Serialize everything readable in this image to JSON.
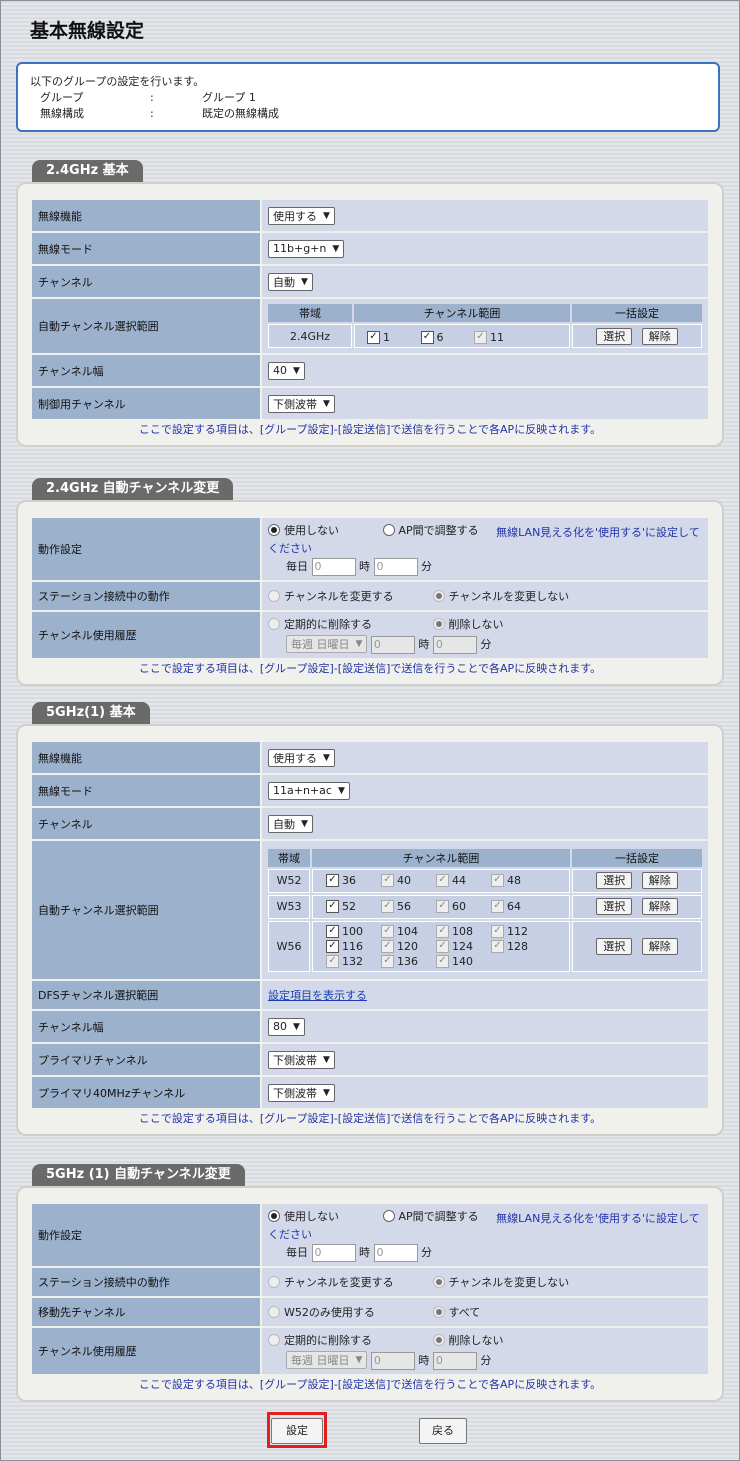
{
  "title": "基本無線設定",
  "info": {
    "intro": "以下のグループの設定を行います。",
    "rows": [
      {
        "key": "グループ",
        "sep": ":",
        "value": "グループ 1"
      },
      {
        "key": "無線構成",
        "sep": ":",
        "value": "既定の無線構成"
      }
    ]
  },
  "note": "ここで設定する項目は、[グループ設定]-[設定送信]で送信を行うことで各APに反映されます。",
  "s24": {
    "tab": "2.4GHz 基本",
    "wireless_func": {
      "label": "無線機能",
      "value": "使用する"
    },
    "mode": {
      "label": "無線モード",
      "value": "11b+g+n"
    },
    "channel": {
      "label": "チャンネル",
      "value": "自動"
    },
    "auto_range": {
      "label": "自動チャンネル選択範囲",
      "hdr_band": "帯域",
      "hdr_range": "チャンネル範囲",
      "hdr_bulk": "一括設定",
      "band": "2.4GHz",
      "ch": [
        "1",
        "6",
        "11"
      ]
    },
    "width": {
      "label": "チャンネル幅",
      "value": "40"
    },
    "control": {
      "label": "制御用チャンネル",
      "value": "下側波帯"
    },
    "btn_select": "選択",
    "btn_clear": "解除"
  },
  "a24": {
    "tab": "2.4GHz 自動チャンネル変更",
    "op": {
      "label": "動作設定",
      "opt1": "使用しない",
      "opt2": "AP間で調整する",
      "warn": "無線LAN見える化を'使用する'に設定してください",
      "daily": "毎日",
      "h_val": "0",
      "h": "時",
      "m_val": "0",
      "m": "分"
    },
    "station": {
      "label": "ステーション接続中の動作",
      "opt1": "チャンネルを変更する",
      "opt2": "チャンネルを変更しない"
    },
    "history": {
      "label": "チャンネル使用履歴",
      "opt1": "定期的に削除する",
      "opt2": "削除しない",
      "weekly": "毎週 日曜日",
      "h_val": "0",
      "h": "時",
      "m_val": "0",
      "m": "分"
    }
  },
  "s5": {
    "tab": "5GHz(1) 基本",
    "wireless_func": {
      "label": "無線機能",
      "value": "使用する"
    },
    "mode": {
      "label": "無線モード",
      "value": "11a+n+ac"
    },
    "channel": {
      "label": "チャンネル",
      "value": "自動"
    },
    "auto_range": {
      "label": "自動チャンネル選択範囲",
      "hdr_band": "帯域",
      "hdr_range": "チャンネル範囲",
      "hdr_bulk": "一括設定",
      "w52": {
        "band": "W52",
        "ch": [
          "36",
          "40",
          "44",
          "48"
        ]
      },
      "w53": {
        "band": "W53",
        "ch": [
          "52",
          "56",
          "60",
          "64"
        ]
      },
      "w56": {
        "band": "W56",
        "ch": [
          "100",
          "104",
          "108",
          "112",
          "116",
          "120",
          "124",
          "128",
          "132",
          "136",
          "140"
        ]
      }
    },
    "dfs": {
      "label": "DFSチャンネル選択範囲",
      "link": "設定項目を表示する"
    },
    "width": {
      "label": "チャンネル幅",
      "value": "80"
    },
    "primary": {
      "label": "プライマリチャンネル",
      "value": "下側波帯"
    },
    "primary40": {
      "label": "プライマリ40MHzチャンネル",
      "value": "下側波帯"
    },
    "btn_select": "選択",
    "btn_clear": "解除"
  },
  "a5": {
    "tab": "5GHz (1) 自動チャンネル変更",
    "op": {
      "label": "動作設定",
      "opt1": "使用しない",
      "opt2": "AP間で調整する",
      "warn": "無線LAN見える化を'使用する'に設定してください",
      "daily": "毎日",
      "h_val": "0",
      "h": "時",
      "m_val": "0",
      "m": "分"
    },
    "station": {
      "label": "ステーション接続中の動作",
      "opt1": "チャンネルを変更する",
      "opt2": "チャンネルを変更しない"
    },
    "dest": {
      "label": "移動先チャンネル",
      "opt1": "W52のみ使用する",
      "opt2": "すべて"
    },
    "history": {
      "label": "チャンネル使用履歴",
      "opt1": "定期的に削除する",
      "opt2": "削除しない",
      "weekly": "毎週 日曜日",
      "h_val": "0",
      "h": "時",
      "m_val": "0",
      "m": "分"
    }
  },
  "buttons": {
    "set": "設定",
    "back": "戻る"
  }
}
